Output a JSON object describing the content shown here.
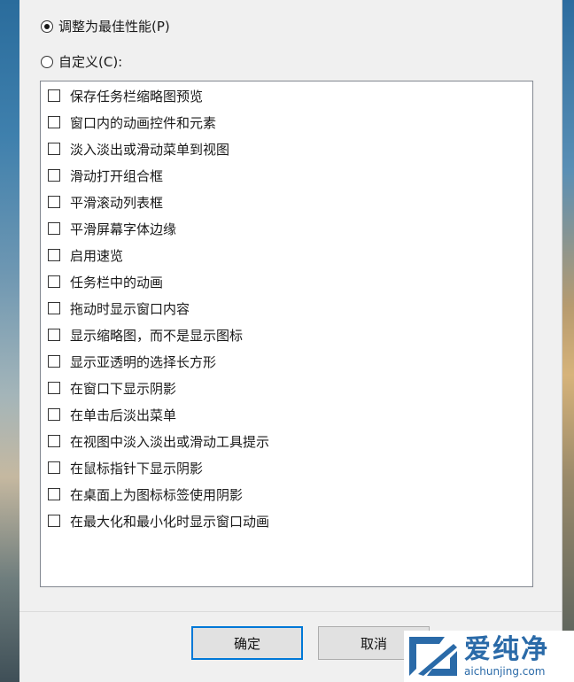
{
  "options": {
    "best_performance": "调整为最佳性能(P)",
    "custom": "自定义(C):"
  },
  "effects": [
    "保存任务栏缩略图预览",
    "窗口内的动画控件和元素",
    "淡入淡出或滑动菜单到视图",
    "滑动打开组合框",
    "平滑滚动列表框",
    "平滑屏幕字体边缘",
    "启用速览",
    "任务栏中的动画",
    "拖动时显示窗口内容",
    "显示缩略图，而不是显示图标",
    "显示亚透明的选择长方形",
    "在窗口下显示阴影",
    "在单击后淡出菜单",
    "在视图中淡入淡出或滑动工具提示",
    "在鼠标指针下显示阴影",
    "在桌面上为图标标签使用阴影",
    "在最大化和最小化时显示窗口动画"
  ],
  "buttons": {
    "ok": "确定",
    "cancel": "取消"
  },
  "watermark": {
    "name": "爱纯净",
    "url": "aichunjing.com"
  }
}
